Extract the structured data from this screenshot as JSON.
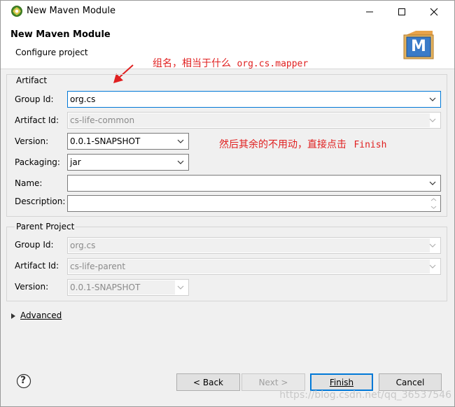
{
  "window": {
    "title": "New Maven Module"
  },
  "banner": {
    "title": "New Maven Module",
    "subtitle": "Configure project",
    "logo_letter": "M"
  },
  "annotations": {
    "group_note_cn": "组名，相当于什么",
    "group_note_code": "org.cs.mapper",
    "finish_note_cn": "然后其余的不用动，直接点击",
    "finish_note_code": "Finish"
  },
  "artifact": {
    "legend": "Artifact",
    "group_id_label": "Group Id:",
    "group_id_value": "org.cs",
    "artifact_id_label": "Artifact Id:",
    "artifact_id_value": "cs-life-common",
    "version_label": "Version:",
    "version_value": "0.0.1-SNAPSHOT",
    "packaging_label": "Packaging:",
    "packaging_value": "jar",
    "name_label": "Name:",
    "name_value": "",
    "description_label": "Description:",
    "description_value": ""
  },
  "parent": {
    "legend": "Parent Project",
    "group_id_label": "Group Id:",
    "group_id_value": "org.cs",
    "artifact_id_label": "Artifact Id:",
    "artifact_id_value": "cs-life-parent",
    "version_label": "Version:",
    "version_value": "0.0.1-SNAPSHOT"
  },
  "advanced": {
    "label": "Advanced"
  },
  "footer": {
    "help_symbol": "?",
    "back_label": "< Back",
    "next_label": "Next >",
    "finish_label": "Finish",
    "cancel_label": "Cancel"
  },
  "watermark": "https://blog.csdn.net/qq_36537546",
  "colors": {
    "accent": "#0078d7",
    "annotation": "#e02020",
    "window_bg": "#f0f0f0"
  }
}
